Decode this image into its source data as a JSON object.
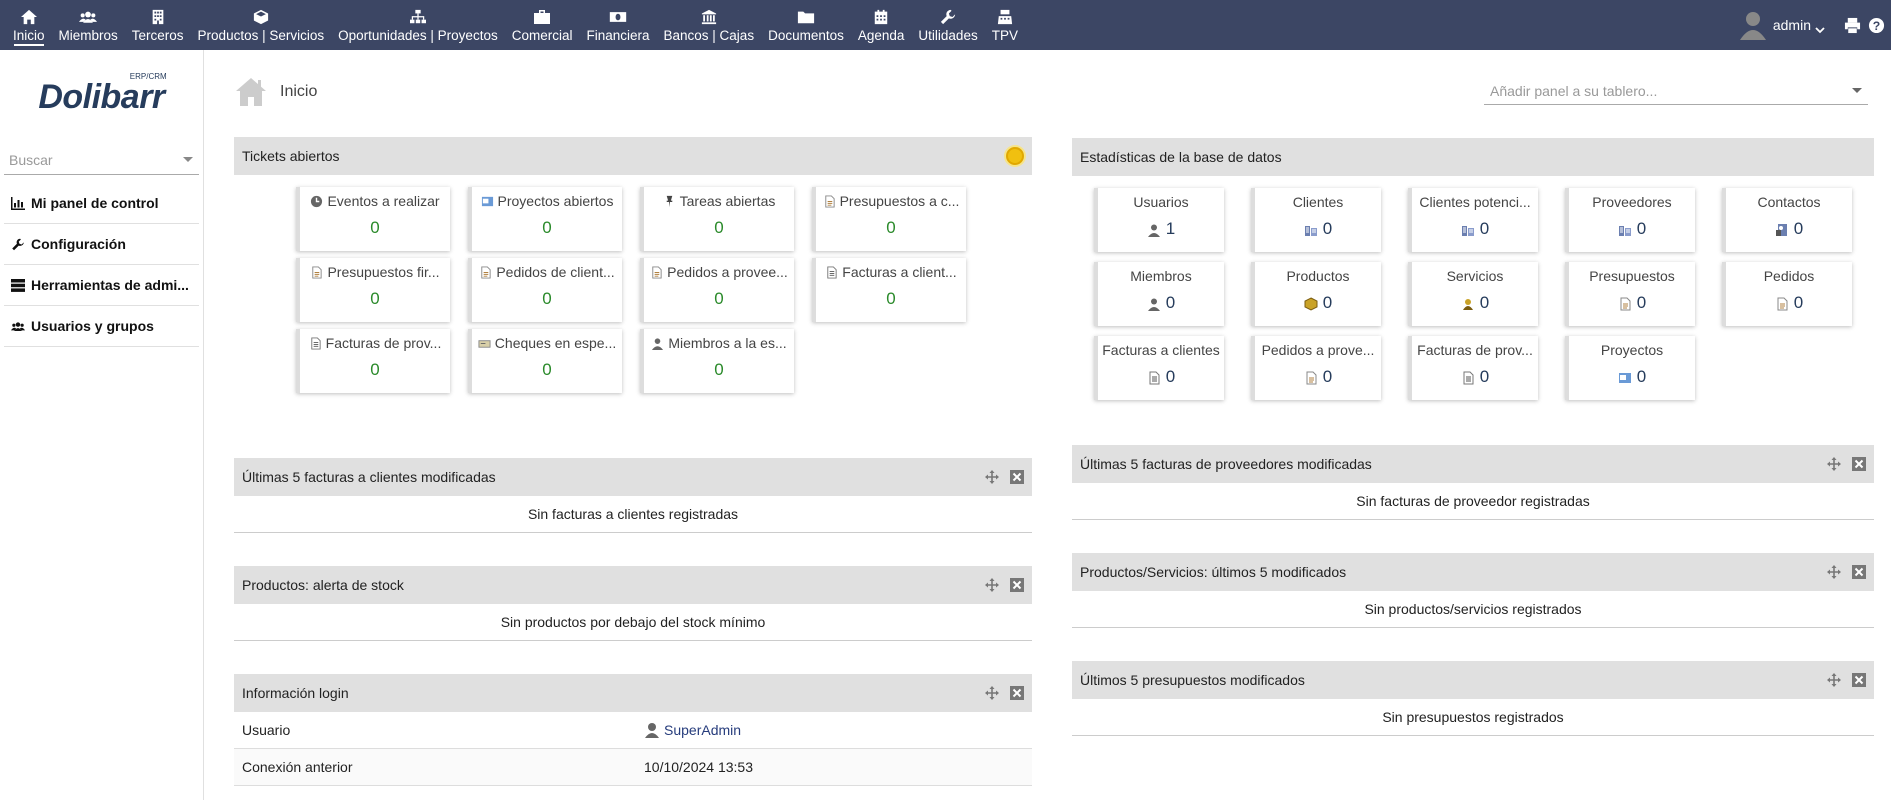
{
  "nav": {
    "items": [
      {
        "label": "Inicio",
        "icon": "home-icon",
        "active": true
      },
      {
        "label": "Miembros",
        "icon": "users-icon"
      },
      {
        "label": "Terceros",
        "icon": "building-icon"
      },
      {
        "label": "Productos | Servicios",
        "icon": "cube-icon"
      },
      {
        "label": "Oportunidades | Proyectos",
        "icon": "sitemap-icon"
      },
      {
        "label": "Comercial",
        "icon": "briefcase-icon"
      },
      {
        "label": "Financiera",
        "icon": "money-icon"
      },
      {
        "label": "Bancos | Cajas",
        "icon": "bank-icon"
      },
      {
        "label": "Documentos",
        "icon": "folder-icon"
      },
      {
        "label": "Agenda",
        "icon": "calendar-icon"
      },
      {
        "label": "Utilidades",
        "icon": "wrench-icon"
      },
      {
        "label": "TPV",
        "icon": "cash-register-icon"
      }
    ],
    "user": "admin"
  },
  "left": {
    "logo": "Dolibarr",
    "logo_sub": "ERP/CRM",
    "search_placeholder": "Buscar",
    "menu": [
      {
        "label": "Mi panel de control",
        "icon": "chart-icon"
      },
      {
        "label": "Configuración",
        "icon": "wrench-icon"
      },
      {
        "label": "Herramientas de admi...",
        "icon": "server-icon"
      },
      {
        "label": "Usuarios y grupos",
        "icon": "users-icon"
      }
    ]
  },
  "page": {
    "title": "Inicio",
    "add_panel_placeholder": "Añadir panel a su tablero..."
  },
  "tickets": {
    "title": "Tickets abiertos",
    "tiles": [
      {
        "label": "Eventos a realizar",
        "value": "0",
        "icon": "clock-icon"
      },
      {
        "label": "Proyectos abiertos",
        "value": "0",
        "icon": "project-icon"
      },
      {
        "label": "Tareas abiertas",
        "value": "0",
        "icon": "pin-icon"
      },
      {
        "label": "Presupuestos a c...",
        "value": "0",
        "icon": "document-icon"
      },
      {
        "label": "Presupuestos fir...",
        "value": "0",
        "icon": "document-icon"
      },
      {
        "label": "Pedidos de client...",
        "value": "0",
        "icon": "document-icon"
      },
      {
        "label": "Pedidos a provee...",
        "value": "0",
        "icon": "document-icon"
      },
      {
        "label": "Facturas a client...",
        "value": "0",
        "icon": "invoice-icon"
      },
      {
        "label": "Facturas de prov...",
        "value": "0",
        "icon": "invoice-icon"
      },
      {
        "label": "Cheques en espe...",
        "value": "0",
        "icon": "cheque-icon"
      },
      {
        "label": "Miembros a la es...",
        "value": "0",
        "icon": "user-icon"
      }
    ]
  },
  "stats": {
    "title": "Estadísticas de la base de datos",
    "tiles": [
      {
        "label": "Usuarios",
        "value": "1",
        "icon": "user-icon"
      },
      {
        "label": "Clientes",
        "value": "0",
        "icon": "company-icon"
      },
      {
        "label": "Clientes potenci...",
        "value": "0",
        "icon": "company-icon"
      },
      {
        "label": "Proveedores",
        "value": "0",
        "icon": "company-icon"
      },
      {
        "label": "Contactos",
        "value": "0",
        "icon": "contact-icon"
      },
      {
        "label": "Miembros",
        "value": "0",
        "icon": "user-icon"
      },
      {
        "label": "Productos",
        "value": "0",
        "icon": "product-icon"
      },
      {
        "label": "Servicios",
        "value": "0",
        "icon": "service-icon"
      },
      {
        "label": "Presupuestos",
        "value": "0",
        "icon": "document-icon"
      },
      {
        "label": "Pedidos",
        "value": "0",
        "icon": "document-icon"
      },
      {
        "label": "Facturas a clientes",
        "value": "0",
        "icon": "invoice-icon"
      },
      {
        "label": "Pedidos a prove...",
        "value": "0",
        "icon": "document-icon"
      },
      {
        "label": "Facturas de prov...",
        "value": "0",
        "icon": "invoice-icon"
      },
      {
        "label": "Proyectos",
        "value": "0",
        "icon": "project-icon"
      }
    ]
  },
  "boxes": {
    "cust_invoices": {
      "title": "Últimas 5 facturas a clientes modificadas",
      "empty": "Sin facturas a clientes registradas"
    },
    "stock": {
      "title": "Productos: alerta de stock",
      "empty": "Sin productos por debajo del stock mínimo"
    },
    "login": {
      "title": "Información login",
      "user_label": "Usuario",
      "user_value": "SuperAdmin",
      "prev_label": "Conexión anterior",
      "prev_value": "10/10/2024 13:53"
    },
    "supp_invoices": {
      "title": "Últimas 5 facturas de proveedores modificadas",
      "empty": "Sin facturas de proveedor registradas"
    },
    "products": {
      "title": "Productos/Servicios: últimos 5 modificados",
      "empty": "Sin productos/servicios registrados"
    },
    "proposals": {
      "title": "Últimos 5 presupuestos modificados",
      "empty": "Sin presupuestos registrados"
    }
  },
  "colors": {
    "topbar": "#3c4664",
    "value_green": "#2a8a2a",
    "value_blue": "#263c5c",
    "box_header": "#e0e0e0"
  }
}
